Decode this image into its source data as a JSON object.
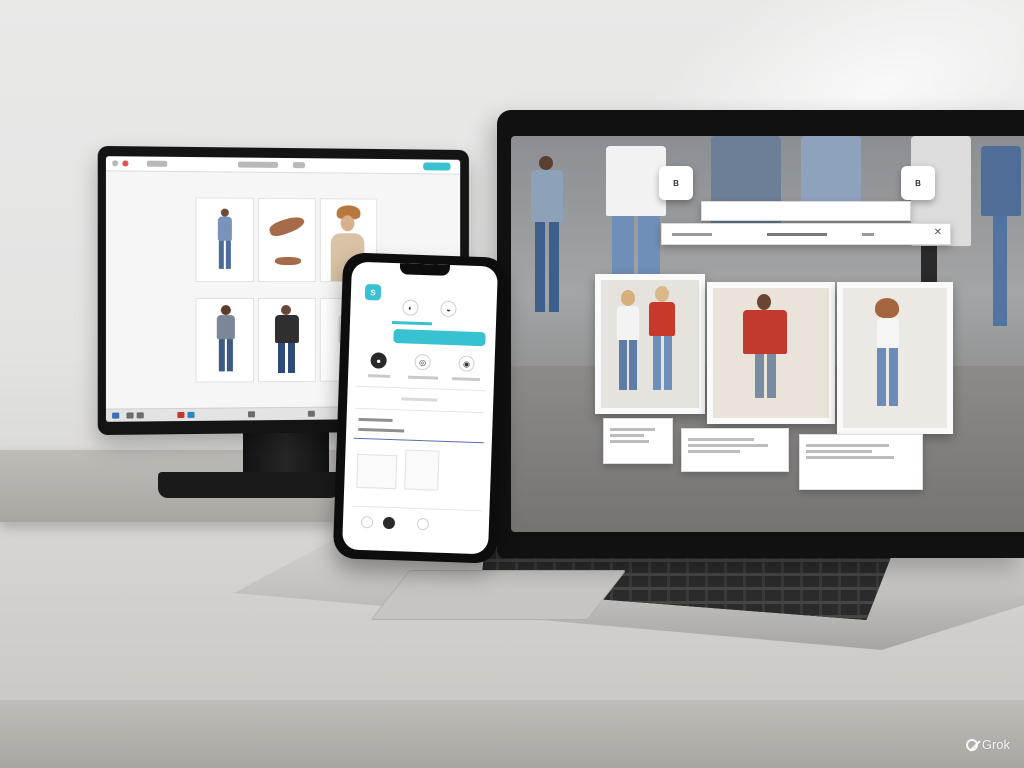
{
  "scene": {
    "devices": [
      "desktop-monitor",
      "laptop",
      "smartphone"
    ],
    "colors": {
      "accent": "#38c1d0",
      "wall": "#e6e6e5",
      "desk": "#d5d3cf",
      "device_black": "#111111",
      "jacket_red": "#c8382b",
      "denim": "#5a7aa3"
    }
  },
  "laptop": {
    "badges": {
      "left": "B",
      "right": "B"
    }
  },
  "phone": {
    "app_badge": "S",
    "icons": [
      "profile-icon",
      "bag-icon",
      "chat-icon",
      "search-icon",
      "filter-icon"
    ]
  },
  "watermark": {
    "text": "Grok"
  }
}
